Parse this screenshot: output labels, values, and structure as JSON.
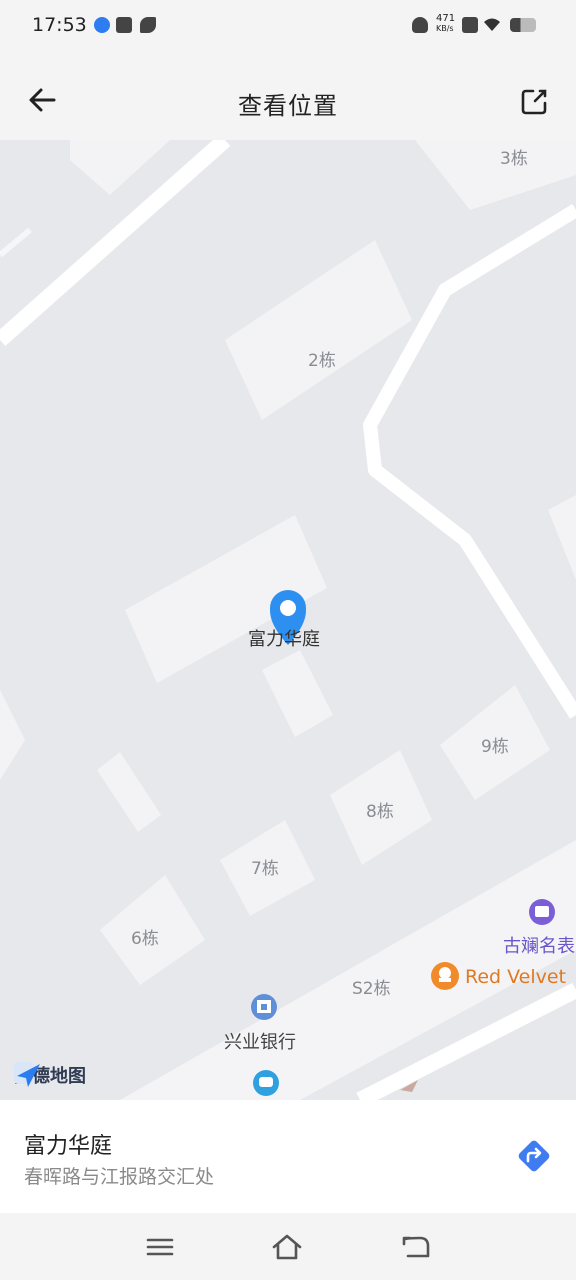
{
  "status_bar": {
    "time": "17:53",
    "speed_value": "471",
    "speed_unit": "KB/s"
  },
  "header": {
    "title": "查看位置",
    "back_icon": "arrow-left-icon",
    "share_icon": "share-icon"
  },
  "map": {
    "buildings": [
      "3栋",
      "2栋",
      "9栋",
      "8栋",
      "7栋",
      "6栋",
      "S2栋"
    ],
    "pin_label": "富力华庭",
    "pois": {
      "shop": "古斓名表",
      "restaurant": "Red Velvet",
      "bank": "兴业银行"
    },
    "provider": "高德地图"
  },
  "place": {
    "name": "富力华庭",
    "address": "春晖路与江报路交汇处"
  },
  "colors": {
    "pin": "#2d8ff0",
    "navigate": "#3f7cf0",
    "poi_purple": "#7a5fd6",
    "poi_orange": "#f08a2a"
  }
}
